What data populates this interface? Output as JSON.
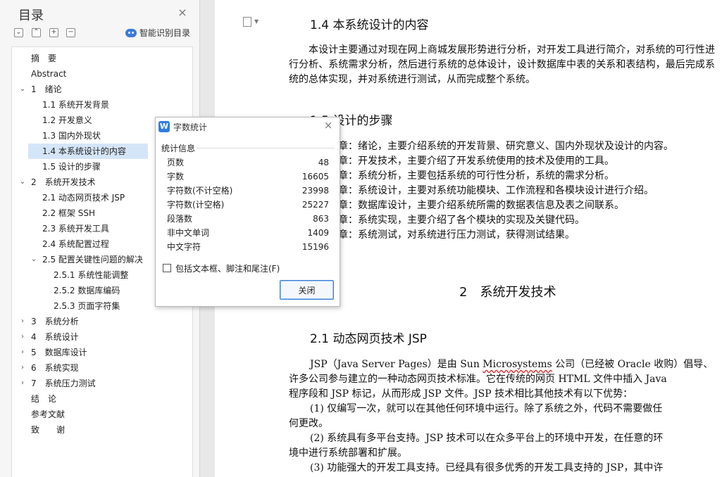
{
  "nav": {
    "title": "目录",
    "close_symbol": "×",
    "tools": [
      "⌄",
      "⌃",
      "+",
      "−"
    ],
    "smart_toc_label": "智能识别目录",
    "items": [
      {
        "label": "摘　要",
        "chevron": ""
      },
      {
        "label": "Abstract",
        "chevron": ""
      },
      {
        "label": "1　绪论",
        "chevron": "⌄"
      },
      {
        "label": "1.1  系统开发背景",
        "chevron": ""
      },
      {
        "label": "1.2  开发意义",
        "chevron": ""
      },
      {
        "label": "1.3  国内外现状",
        "chevron": ""
      },
      {
        "label": "1.4  本系统设计的内容",
        "chevron": ""
      },
      {
        "label": "1.5  设计的步骤",
        "chevron": ""
      },
      {
        "label": "2　系统开发技术",
        "chevron": "⌄"
      },
      {
        "label": "2.1  动态网页技术 JSP",
        "chevron": ""
      },
      {
        "label": "2.2  框架 SSH",
        "chevron": ""
      },
      {
        "label": "2.3  系统开发工具",
        "chevron": ""
      },
      {
        "label": "2.4  系统配置过程",
        "chevron": ""
      },
      {
        "label": "2.5  配置关键性问题的解决",
        "chevron": "⌄"
      },
      {
        "label": "2.5.1  系统性能调整",
        "chevron": ""
      },
      {
        "label": "2.5.2  数据库编码",
        "chevron": ""
      },
      {
        "label": "2.5.3  页面字符集",
        "chevron": ""
      },
      {
        "label": "3　系统分析",
        "chevron": "›"
      },
      {
        "label": "4　系统设计",
        "chevron": "›"
      },
      {
        "label": "5　数据库设计",
        "chevron": "›"
      },
      {
        "label": "6　系统实现",
        "chevron": "›"
      },
      {
        "label": "7　系统压力测试",
        "chevron": "›"
      },
      {
        "label": "结　论",
        "chevron": ""
      },
      {
        "label": "参考文献",
        "chevron": ""
      },
      {
        "label": "致　　谢",
        "chevron": ""
      }
    ]
  },
  "doc": {
    "h_1_4": "1.4  本系统设计的内容",
    "p_1_4": "本设计主要通过对现在网上商城发展形势进行分析，对开发工具进行简介，对系统的可行性进行分析、系统需求分析，然后进行系统的总体设计，设计数据库中表的关系和表结构，最后完成系统的总体实现，并对系统进行测试，从而完成整个系统。",
    "h_1_5": "1.5  设计的步骤",
    "steps": [
      "章：绪论，主要介绍系统的开发背景、研究意义、国内外现状及设计的内容。",
      "章：开发技术，主要介绍了开发系统使用的技术及使用的工具。",
      "章：系统分析，主要包括系统的可行性分析，系统的需求分析。",
      "章：系统设计，主要对系统功能模块、工作流程和各模块设计进行介绍。",
      "章：数据库设计，主要介绍系统所需的数据表信息及表之间联系。",
      "章：系统实现，主要介绍了各个模块的实现及关键代码。",
      "章：系统测试，对系统进行压力测试，获得测试结果。"
    ],
    "h_2": "2　系统开发技术",
    "h_2_1": "2.1  动态网页技术 JSP",
    "lines_2_1": [
      {
        "pre": "JSP（Java Server Pages）是由 Sun ",
        "mark": "Microsystems",
        "post": " 公司（已经被 Oracle 收购）倡导、"
      },
      {
        "pre": "许多公司参与建立的一种动态网页技术标准。它在传统的网页 HTML 文件中插入 Java",
        "mark": "",
        "post": ""
      },
      {
        "pre": "程序段和 JSP 标记，从而形成 JSP 文件。JSP 技术相比其他技术有以下优势：",
        "mark": "",
        "post": ""
      },
      {
        "pre": "(1) 仅编写一次，就可以在其他任何环境中运行。除了系统之外，代码不需要做任",
        "mark": "",
        "post": ""
      },
      {
        "pre": "何更改。",
        "mark": "",
        "post": ""
      },
      {
        "pre": "(2) 系统具有多平台支持。JSP 技术可以在众多平台上的环境中开发，在任意的环",
        "mark": "",
        "post": ""
      },
      {
        "pre": "境中进行系统部署和扩展。",
        "mark": "",
        "post": ""
      },
      {
        "pre": "(3) 功能强大的开发工具支持。已经具有很多优秀的开发工具支持的 JSP，其中许",
        "mark": "",
        "post": ""
      }
    ]
  },
  "dialog": {
    "icon_letter": "W",
    "title": "字数统计",
    "close_symbol": "×",
    "section_label": "统计信息",
    "stats": [
      {
        "label": "页数",
        "value": "48"
      },
      {
        "label": "字数",
        "value": "16605"
      },
      {
        "label": "字符数(不计空格)",
        "value": "23998"
      },
      {
        "label": "字符数(计空格)",
        "value": "25227"
      },
      {
        "label": "段落数",
        "value": "863"
      },
      {
        "label": "非中文单词",
        "value": "1409"
      },
      {
        "label": "中文字符",
        "value": "15196"
      }
    ],
    "checkbox_label": "包括文本框、脚注和尾注(F)",
    "checkbox_checked": false,
    "close_button_label": "关闭"
  }
}
